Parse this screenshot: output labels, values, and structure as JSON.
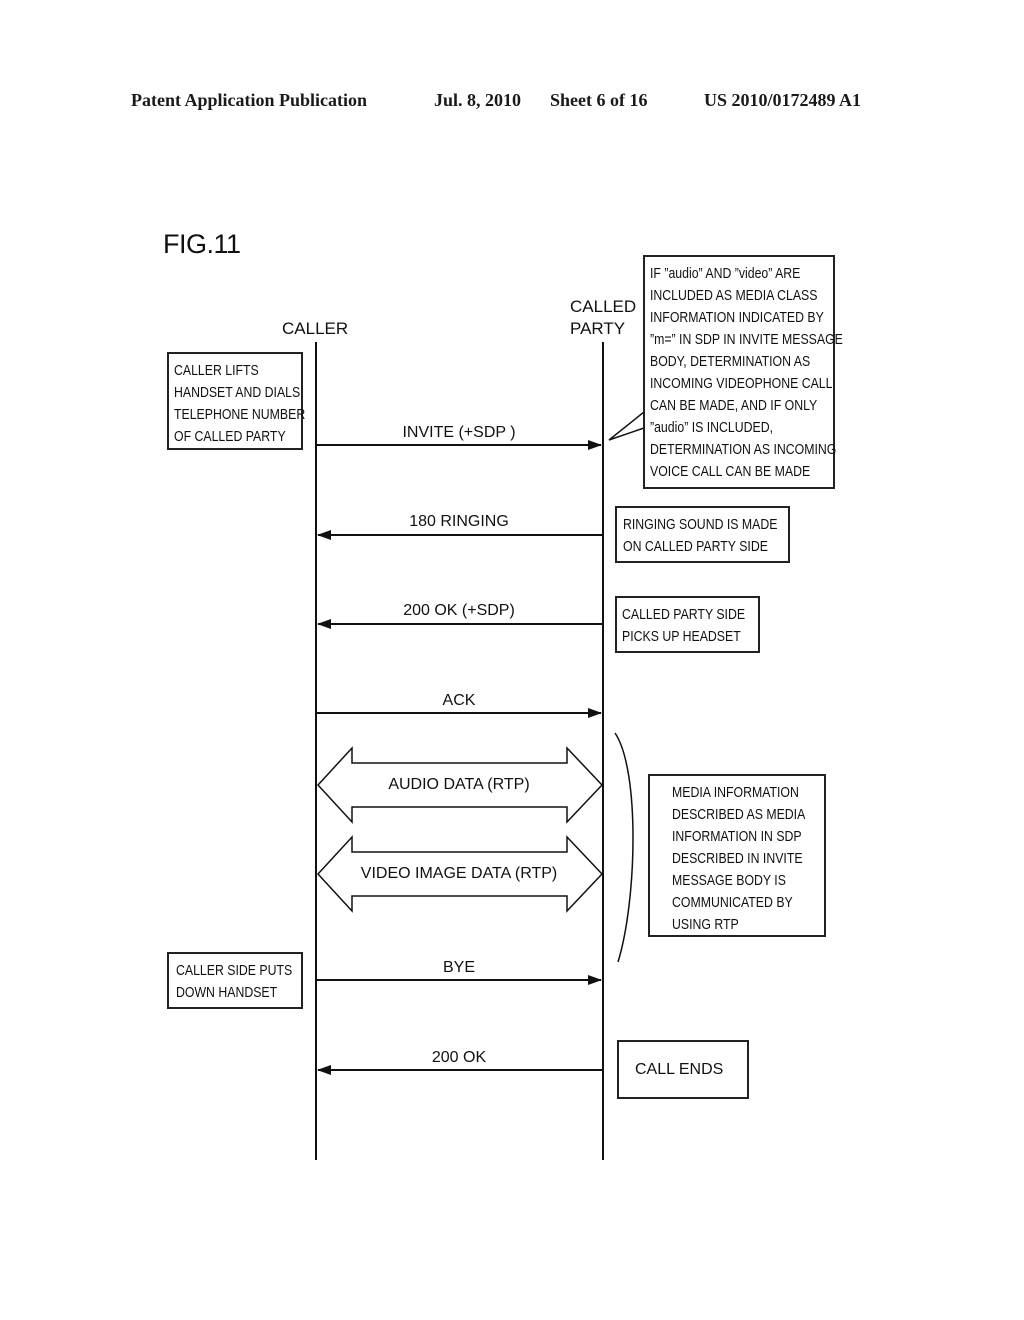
{
  "header": {
    "publication": "Patent Application Publication",
    "date": "Jul. 8, 2010",
    "sheet": "Sheet 6 of 16",
    "number": "US 2010/0172489 A1"
  },
  "figure_label": "FIG.11",
  "actors": {
    "caller": "CALLER",
    "called_party_line1": "CALLED",
    "called_party_line2": "PARTY"
  },
  "messages": [
    {
      "label": "INVITE (+SDP )",
      "direction": "caller-to-called"
    },
    {
      "label": "180 RINGING",
      "direction": "called-to-caller"
    },
    {
      "label": "200 OK (+SDP)",
      "direction": "called-to-caller"
    },
    {
      "label": "ACK",
      "direction": "caller-to-called"
    },
    {
      "label": "AUDIO DATA (RTP)",
      "direction": "bidirectional"
    },
    {
      "label": "VIDEO IMAGE DATA (RTP)",
      "direction": "bidirectional"
    },
    {
      "label": "BYE",
      "direction": "caller-to-called"
    },
    {
      "label": "200 OK",
      "direction": "called-to-caller"
    }
  ],
  "notes": {
    "caller_dials": [
      "CALLER LIFTS",
      "HANDSET AND DIALS",
      "TELEPHONE NUMBER",
      "OF CALLED PARTY"
    ],
    "sdp_determination": [
      "IF ”audio” AND ”video” ARE",
      "INCLUDED AS MEDIA CLASS",
      "INFORMATION INDICATED BY",
      "”m=” IN SDP IN INVITE MESSAGE",
      "BODY, DETERMINATION AS",
      "INCOMING VIDEOPHONE CALL",
      "CAN BE MADE, AND IF ONLY",
      "”audio” IS INCLUDED,",
      "DETERMINATION AS INCOMING",
      "VOICE CALL CAN BE MADE"
    ],
    "ringing": [
      "RINGING SOUND IS MADE",
      "ON CALLED PARTY SIDE"
    ],
    "picks_up": [
      "CALLED PARTY SIDE",
      "PICKS UP HEADSET"
    ],
    "media_info": [
      "MEDIA INFORMATION",
      "DESCRIBED AS MEDIA",
      "INFORMATION IN SDP",
      "DESCRIBED IN INVITE",
      "MESSAGE BODY IS",
      "COMMUNICATED BY",
      "USING RTP"
    ],
    "caller_hangs_up": [
      "CALLER SIDE PUTS",
      "DOWN HANDSET"
    ],
    "call_ends": [
      "CALL ENDS"
    ]
  }
}
